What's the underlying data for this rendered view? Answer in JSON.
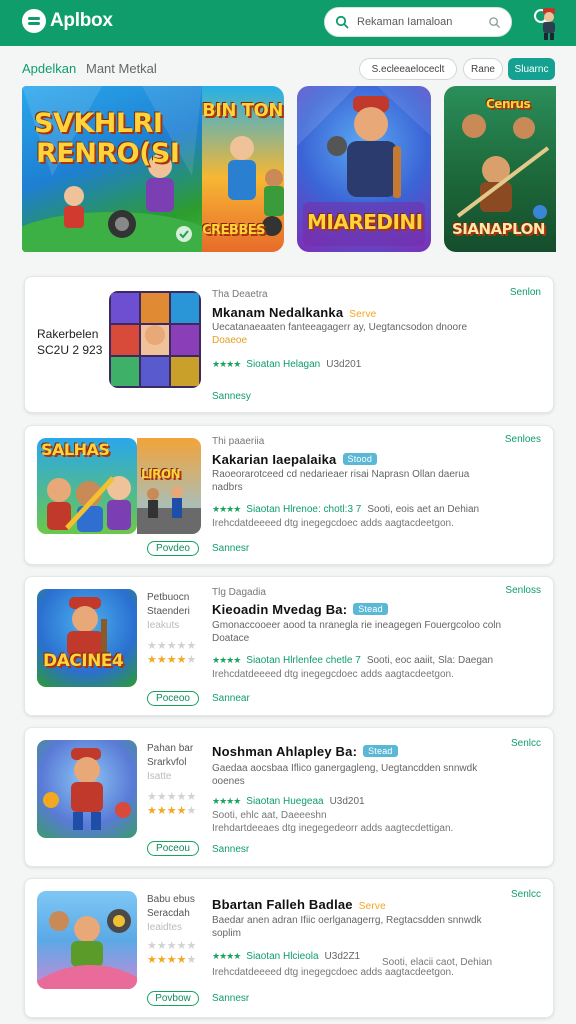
{
  "app": {
    "name": "Aplbox"
  },
  "header": {
    "search_placeholder": "Rekaman Iamaloan",
    "search_icon": "search-icon",
    "clear_icon": "search-clear-icon",
    "avatar": "profile-avatar-icon"
  },
  "subnav": {
    "active": "Apdelkan",
    "item": "Mant Metkal",
    "filter_label": "S.ecleeaeloceclt",
    "filter_short": "Rane",
    "cta": "Sluarnc"
  },
  "featured": [
    {
      "title_line1": "SVKHLRI",
      "title_line2": "RENRO(SI"
    },
    {
      "title_top": "BIN TON",
      "title_bottom": "CREBBES"
    },
    {
      "title": "MIAREDINI"
    },
    {
      "title_top": "Cenrus",
      "title": "SIANAPLON"
    }
  ],
  "cards": [
    {
      "left_label_1": "Rakerbelen",
      "left_label_2": "SC2U 2 923",
      "category": "Tha Deaetra",
      "title": "Mkanam Nedalkanka",
      "badge": "Serve",
      "desc_1": "Uecatanaeaaten fanteeagagerr ay, Uegtancsodon dnoore",
      "desc_2": "Doaeoe",
      "rating_text": "Sioatan Helagan",
      "rating_extra": "U3d201",
      "footer": "Sannesy",
      "side_link": "Senlon"
    },
    {
      "thumb_top_left": "SALHAS",
      "thumb_top_right": "LIRON",
      "category": "Thi paaeriia",
      "title": "Kakarian Iaepalaika",
      "badge": "Stood",
      "desc_1": "Raoeorarotceed cd nedarieaer risai Naprasn Ollan daerua",
      "desc_2": "nadbrs",
      "rating_text": "Siaotan Hlrenoe: chotl:3 7",
      "rating_extra": "Sooti, eois aet an Dehian",
      "rating_extra_2": "Irehcdatdeeeed dtg inegegcdoec adds aagtacdeetgon.",
      "price": "Povdeo",
      "footer": "Sannesr",
      "side_link": "Senloes"
    },
    {
      "left_label_1": "Petbuocn",
      "left_label_2": "Staenderi",
      "left_label_3": "Ieakuts",
      "thumb_text": "DACINE4",
      "category": "Tlg Dagadia",
      "title": "Kieoadin Mvedag Ba:",
      "badge": "Stead",
      "desc_1": "Gmonaccooeer aood ta nranegla rie ineagegen Fouergcoloo coln",
      "desc_2": "Doatace",
      "rating_text": "Siaotan Hlrlenfee chetle 7",
      "rating_extra": "Sooti, eoc aaiit, Sla: Daegan",
      "rating_extra_2": "Irehcdatdeeeed dtg inegegcdoec adds aagtacdeetgon.",
      "price": "Poceoo",
      "footer": "Sannear",
      "side_link": "Senloss"
    },
    {
      "left_label_1": "Pahan bar",
      "left_label_2": "Srarkvfol",
      "left_label_3": "Isatte",
      "title": "Noshman Ahlapley Ba:",
      "badge": "Stead",
      "desc_1": "Gaedaa aocsbaa Iflico ganergagleng, Uegtancdden snnwdk",
      "desc_2": "ooenes",
      "rating_text": "Siaotan Huegeaa",
      "rating_extra": "U3d201",
      "rating_extra_2": "Sooti, ehlc aat, Daeeeshn",
      "rating_extra_3": "Irehdartdeeaes dtg inegegedeorr adds aagtecdettigan.",
      "price": "Poceou",
      "footer": "Sannesr",
      "side_link": "Senlcc"
    },
    {
      "left_label_1": "Babu ebus",
      "left_label_2": "Seracdah",
      "left_label_3": "Ieaidtes",
      "title": "Bbartan Falleh Badlae",
      "badge": "Serve",
      "desc_1": "Baedar anen adran Ifiic oerlganagerrg, Regtacsdden snnwdk",
      "desc_2": "soplim",
      "rating_text": "Siaotan Hlcieola",
      "rating_extra": "U3d2Z1",
      "rating_extra_2": "Sooti, elacii caot, Dehian",
      "rating_extra_3": "Irehcdatdeeeed dtg inegegcdoec adds aagtacdeetgon.",
      "price": "Povbow",
      "footer": "Sannesr",
      "side_link": "Senlcc"
    }
  ],
  "colors": {
    "brand": "#0f9d6b",
    "accent": "#14a191",
    "star_gold": "#f2a821"
  }
}
